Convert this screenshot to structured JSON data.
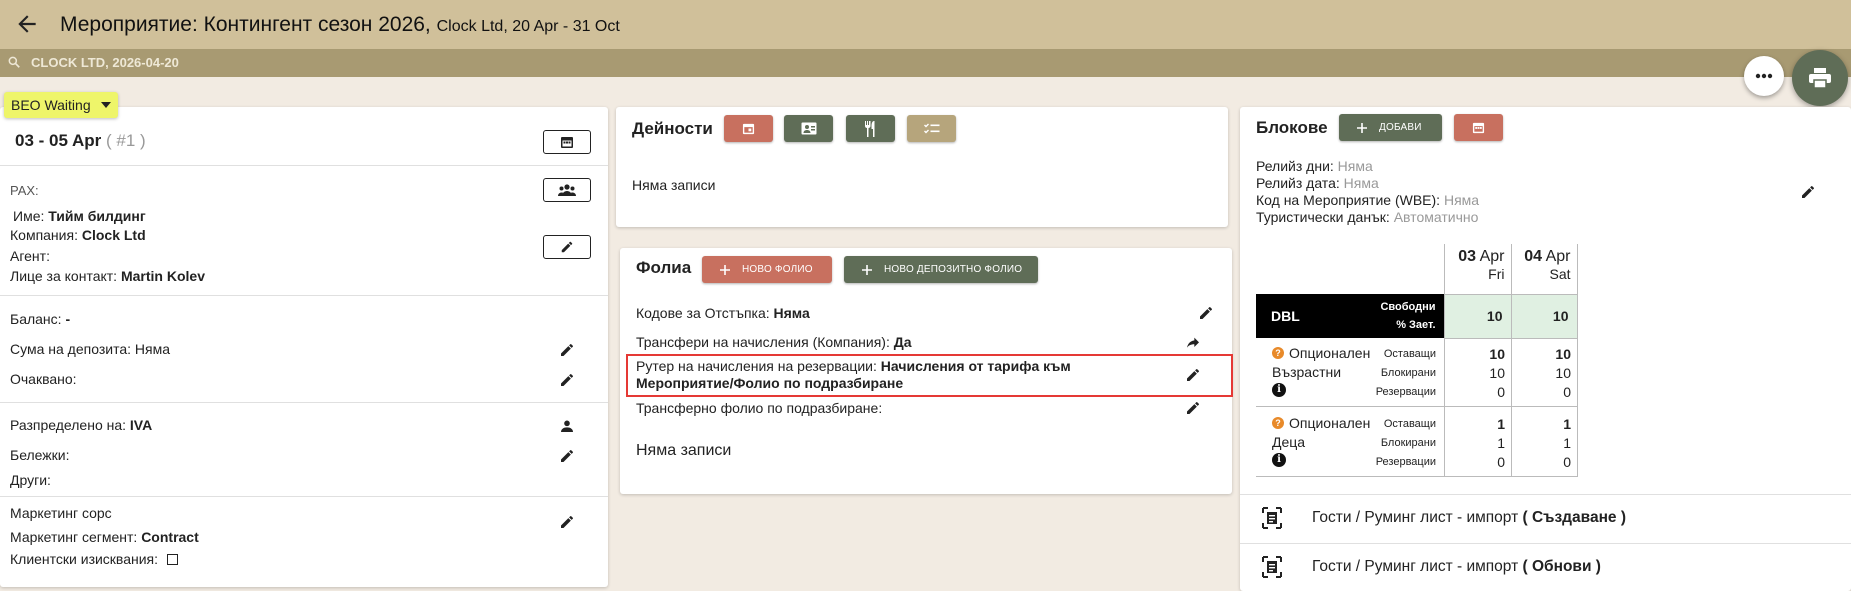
{
  "header": {
    "title_main": "Мероприятие: Контингент сезон 2026,",
    "title_sub": "Clock Ltd, 20 Apr - 31 Oct",
    "search_text": "CLOCK LTD, 2026-04-20"
  },
  "status": {
    "value": "BEO Waiting"
  },
  "left": {
    "dates": "03 - 05 Apr",
    "index": "( #1 )",
    "pax_label": "PAX:",
    "name_label": "Име:",
    "name_value": "Тийм билдинг",
    "company_label": "Компания:",
    "company_value": "Clock Ltd",
    "agent_label": "Агент:",
    "contact_label": "Лице за контакт:",
    "contact_value": "Martin Kolev",
    "balance_label": "Баланс:",
    "balance_value": "-",
    "deposit_label": "Сума на депозита:",
    "deposit_value": "Няма",
    "expected_label": "Очаквано:",
    "assigned_label": "Разпределено на:",
    "assigned_value": "IVA",
    "notes_label": "Бележки:",
    "others_label": "Други:",
    "marketing_source_label": "Маркетинг сорс",
    "marketing_segment_label": "Маркетинг сегмент:",
    "marketing_segment_value": "Contract",
    "client_req_label": "Клиентски изисквания:"
  },
  "activities": {
    "title": "Дейности",
    "empty": "Няма записи"
  },
  "folios": {
    "title": "Фолиа",
    "new_btn": "НОВО ФОЛИО",
    "new_deposit_btn": "НОВО ДЕПОЗИТНО ФОЛИО",
    "discount_label": "Кодове за Отстъпка:",
    "discount_value": "Няма",
    "transfers_label": "Трансфери на начисления (Компания):",
    "transfers_value": "Да",
    "router_label": "Рутер на начисления на резервации:",
    "router_value_1": "Начисления от тарифа към",
    "router_value_2": "Мероприятие/Фолио по подразбиране",
    "transfer_folio_label": "Трансферно фолио по подразбиране:",
    "empty": "Няма записи"
  },
  "blocks": {
    "title": "Блокове",
    "add_btn": "ДОБАВИ",
    "release_days_label": "Релийз дни:",
    "release_days_value": "Няма",
    "release_date_label": "Релийз дата:",
    "release_date_value": "Няма",
    "code_label": "Код на Мероприятие (WBE):",
    "code_value": "Няма",
    "tax_label": "Туристически данък:",
    "tax_value": "Автоматично",
    "days": [
      {
        "date": "03",
        "month": "Apr",
        "dow": "Fri"
      },
      {
        "date": "04",
        "month": "Apr",
        "dow": "Sat"
      }
    ],
    "room_type": "DBL",
    "free_label": "Свободни",
    "occ_label": "% Зает.",
    "free_values": [
      "10",
      "10"
    ],
    "groups": [
      {
        "name1": "Опционален",
        "name2": "Възрастни",
        "rows": [
          {
            "label": "Оставащи",
            "values": [
              "10",
              "10"
            ]
          },
          {
            "label": "Блокирани",
            "values": [
              "10",
              "10"
            ]
          },
          {
            "label": "Резервации",
            "values": [
              "0",
              "0"
            ]
          }
        ]
      },
      {
        "name1": "Опционален",
        "name2": "Деца",
        "rows": [
          {
            "label": "Оставащи",
            "values": [
              "1",
              "1"
            ]
          },
          {
            "label": "Блокирани",
            "values": [
              "1",
              "1"
            ]
          },
          {
            "label": "Резервации",
            "values": [
              "0",
              "0"
            ]
          }
        ]
      }
    ],
    "import_create_label": "Гости / Руминг лист - импорт",
    "import_create_action": "( Създаване )",
    "import_update_label": "Гости / Руминг лист - импорт",
    "import_update_action": "( Обнови )"
  },
  "colors": {
    "header": "#d0c09a",
    "subbar": "#a89a72",
    "accent_red": "#c8705f",
    "accent_green": "#5f6d57",
    "accent_tan": "#b6a57c",
    "status_yellow": "#eef56a",
    "highlight": "#e53935"
  },
  "icons": [
    "arrow-left-icon",
    "search-icon",
    "more-horiz-icon",
    "print-icon",
    "chevron-down-icon",
    "calendar-icon",
    "group-icon",
    "pencil-icon",
    "person-icon",
    "id-card-icon",
    "restaurant-icon",
    "checklist-icon",
    "plus-icon",
    "forward-icon",
    "help-icon",
    "info-icon",
    "import-doc-icon"
  ]
}
